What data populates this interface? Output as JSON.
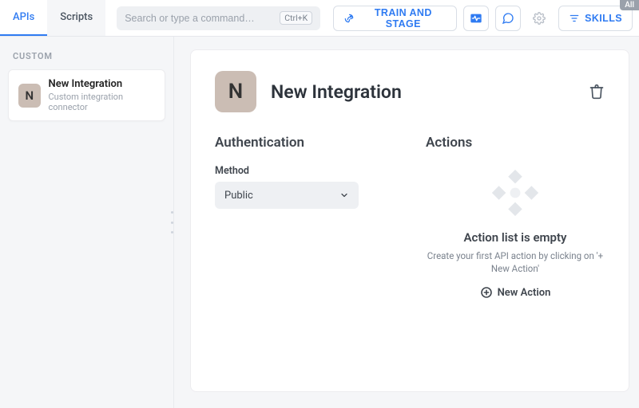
{
  "corner_tag": "All",
  "tabs": {
    "apis": "APIs",
    "scripts": "Scripts"
  },
  "search": {
    "placeholder": "Search or type a command…",
    "shortcut": "Ctrl+K"
  },
  "top_buttons": {
    "train": "TRAIN AND STAGE",
    "skills": "SKILLS"
  },
  "sidebar": {
    "heading": "CUSTOM",
    "item": {
      "initial": "N",
      "title": "New Integration",
      "subtitle": "Custom integration connector"
    }
  },
  "panel": {
    "initial": "N",
    "title": "New Integration"
  },
  "auth": {
    "heading": "Authentication",
    "method_label": "Method",
    "method_value": "Public"
  },
  "actions": {
    "heading": "Actions",
    "empty_title": "Action list is empty",
    "empty_sub": "Create your first API action by clicking on '+ New Action'",
    "new_action": "New Action"
  }
}
